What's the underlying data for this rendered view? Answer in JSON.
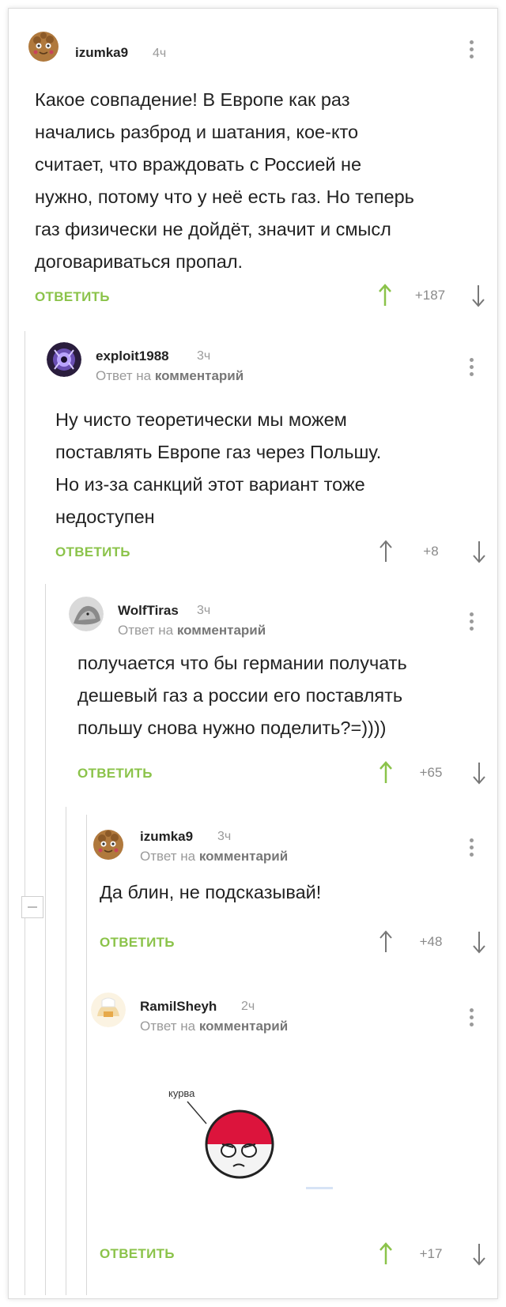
{
  "comments": [
    {
      "author": "izumka9",
      "time": "4ч",
      "reply_prefix": "",
      "reply_link": "",
      "lines": [
        "Какое совпадение! В Европе как раз",
        "начались разброд и шатания, кое-кто",
        "считает, что враждовать с Россией не",
        "нужно, потому что у неё есть газ. Но теперь",
        "газ физически не дойдёт, значит и смысл",
        "договариваться пропал."
      ],
      "reply_label": "ОТВЕТИТЬ",
      "score": "+187",
      "vote_up_active": true
    },
    {
      "author": "exploit1988",
      "time": "3ч",
      "reply_prefix": "Ответ на ",
      "reply_link": "комментарий",
      "lines": [
        "Ну чисто теоретически мы можем",
        "поставлять Европе газ через Польшу.",
        "Но из-за санкций этот вариант тоже",
        "недоступен"
      ],
      "reply_label": "ОТВЕТИТЬ",
      "score": "+8",
      "vote_up_active": false
    },
    {
      "author": "WolfTiras",
      "time": "3ч",
      "reply_prefix": "Ответ на ",
      "reply_link": "комментарий",
      "lines": [
        "получается что бы германии получать",
        "дешевый газ а россии его поставлять",
        "польшу снова нужно поделить?=))))"
      ],
      "reply_label": "ОТВЕТИТЬ",
      "score": "+65",
      "vote_up_active": true
    },
    {
      "author": "izumka9",
      "time": "3ч",
      "reply_prefix": "Ответ на ",
      "reply_link": "комментарий",
      "lines": [
        "Да блин, не подсказывай!"
      ],
      "reply_label": "ОТВЕТИТЬ",
      "score": "+48",
      "vote_up_active": false
    },
    {
      "author": "RamilSheyh",
      "time": "2ч",
      "reply_prefix": "Ответ на ",
      "reply_link": "комментарий",
      "lines": [],
      "image_caption": "курва",
      "reply_label": "ОТВЕТИТЬ",
      "score": "+17",
      "vote_up_active": true
    }
  ],
  "colors": {
    "accent_green": "#8bc34a",
    "muted_gray": "#9a9a9a",
    "text": "#222222",
    "thread_line": "#d8d8d8"
  },
  "icons": [
    "more-dots-icon",
    "arrow-up-icon",
    "arrow-down-icon",
    "collapse-thread-icon"
  ]
}
